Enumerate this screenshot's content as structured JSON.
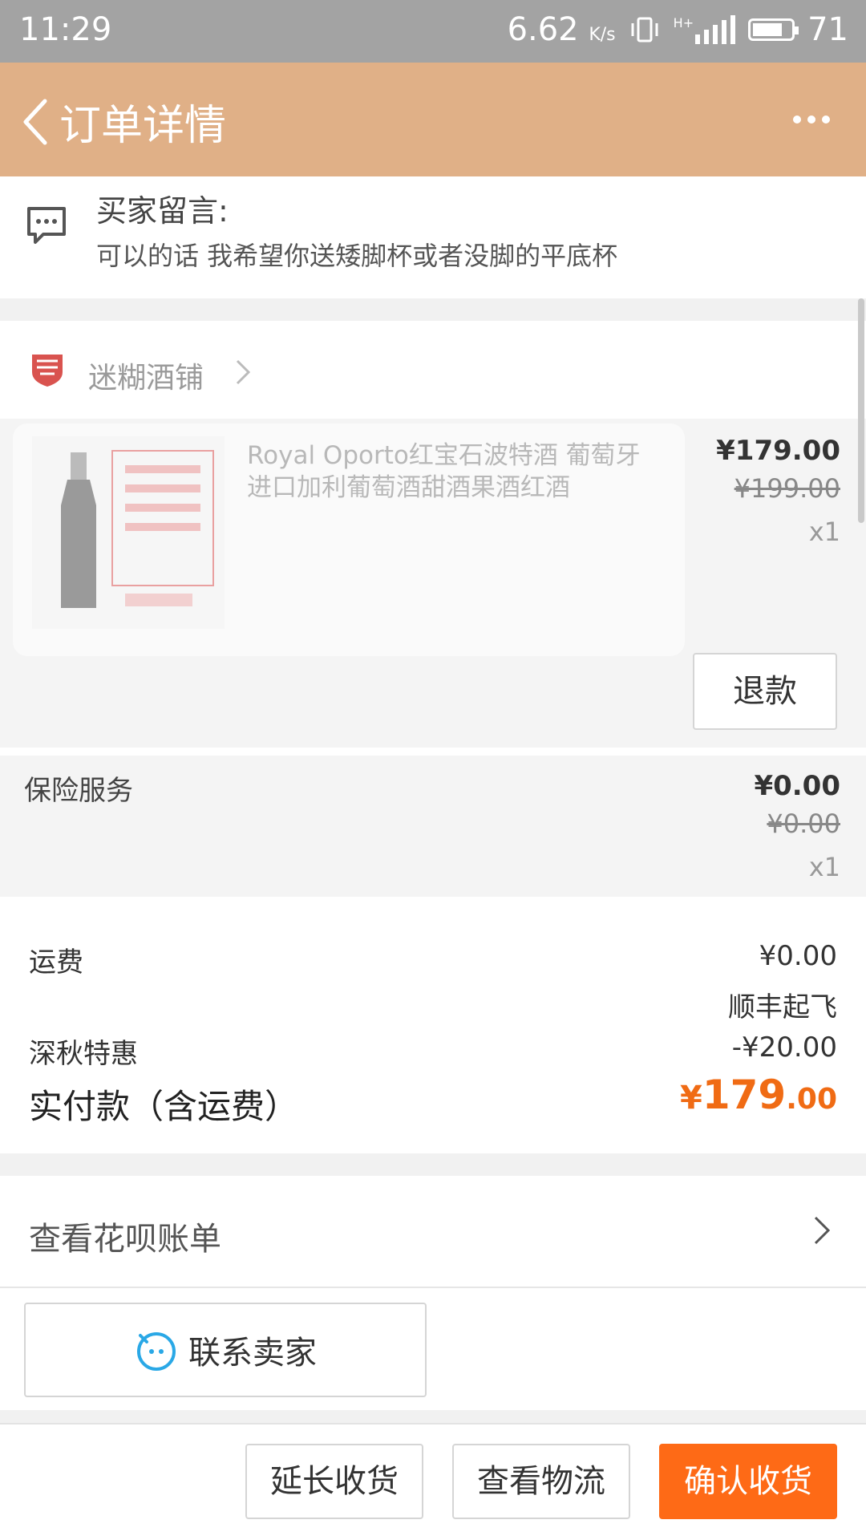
{
  "status_bar": {
    "time": "11:29",
    "speed": "6.62",
    "speed_unit": "K/s",
    "network": "H+",
    "battery": "71"
  },
  "header": {
    "title": "订单详情",
    "back_icon": "chevron-left-icon",
    "more_icon": "more-dots-icon",
    "background": "#e0b087"
  },
  "buyer_note": {
    "label": "买家留言:",
    "message": "可以的话 我希望你送矮脚杯或者没脚的平底杯",
    "icon": "message-icon"
  },
  "shop": {
    "name": "迷糊酒铺",
    "icon": "shop-logo"
  },
  "product": {
    "title": "Royal Oporto红宝石波特酒 葡萄牙进口加利葡萄酒甜酒果酒红酒",
    "price": "¥179.00",
    "original_price": "¥199.00",
    "quantity": "x1",
    "refund_label": "退款"
  },
  "insurance": {
    "label": "保险服务",
    "price": "¥0.00",
    "original_price": "¥0.00",
    "quantity": "x1"
  },
  "summary": {
    "shipping_label": "运费",
    "shipping_value": "¥0.00",
    "shipping_method": "顺丰起飞",
    "discount_label": "深秋特惠",
    "discount_value": "-¥20.00",
    "paid_label": "实付款（含运费）",
    "paid_currency": "¥",
    "paid_integer": "179",
    "paid_decimal": ".00",
    "accent_color": "#f06b14"
  },
  "huabei": {
    "label": "查看花呗账单"
  },
  "contact": {
    "label": "联系卖家"
  },
  "actions": {
    "extend": "延长收货",
    "logistics": "查看物流",
    "confirm": "确认收货",
    "confirm_color": "#fe6a16"
  }
}
